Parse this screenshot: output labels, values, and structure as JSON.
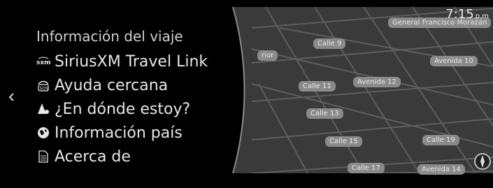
{
  "clock": {
    "time": "7:15",
    "ampm": "p.m"
  },
  "menu": {
    "title": "Información del viaje",
    "items": [
      {
        "label": "SiriusXM Travel Link",
        "icon": "sxm-icon"
      },
      {
        "label": "Ayuda cercana",
        "icon": "sos-icon"
      },
      {
        "label": "¿En dónde estoy?",
        "icon": "location-pin-icon"
      },
      {
        "label": "Información país",
        "icon": "globe-icon"
      },
      {
        "label": "Acerca de",
        "icon": "document-icon"
      }
    ]
  },
  "map": {
    "labels": [
      "General Francisco Morazán",
      "Calle 9",
      "rior",
      "Avenida 10",
      "Avenida 12",
      "Calle 11",
      "Calle 13",
      "Calle 15",
      "Calle 19",
      "Calle 17",
      "Avenida 14"
    ]
  },
  "colors": {
    "background": "#000000",
    "map_fill": "#3b3b3b",
    "road": "#595959",
    "text": "#e6e6e6"
  }
}
